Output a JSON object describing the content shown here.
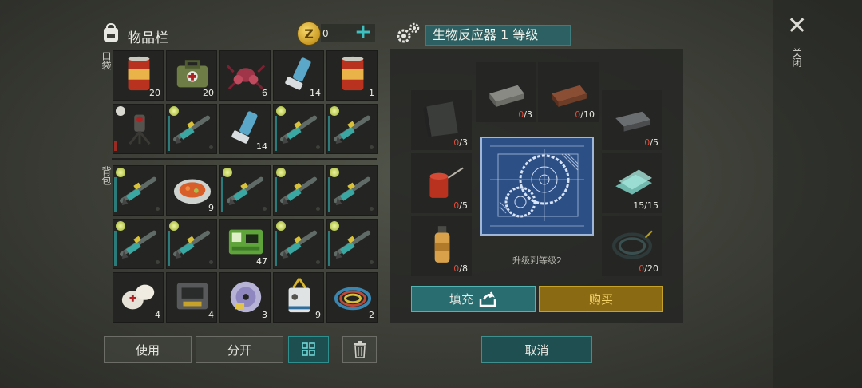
{
  "inventory": {
    "title": "物品栏",
    "coins": "0",
    "coin_symbol": "Z",
    "plus": "+",
    "pocket_label": "口袋",
    "backpack_label": "背包",
    "pocket": [
      {
        "name": "canned-food-icon",
        "count": "20"
      },
      {
        "name": "medkit-icon",
        "count": "20"
      },
      {
        "name": "mutant-spider-icon",
        "count": "6"
      },
      {
        "name": "inhaler-icon",
        "count": "14"
      },
      {
        "name": "canned-food-icon",
        "count": "1"
      },
      {
        "name": "turret-icon",
        "count": ""
      },
      {
        "name": "rifle-icon",
        "count": ""
      },
      {
        "name": "inhaler-icon",
        "count": "14"
      },
      {
        "name": "rifle-icon",
        "count": ""
      },
      {
        "name": "rifle-icon",
        "count": ""
      }
    ],
    "backpack": [
      {
        "name": "rifle-icon",
        "count": ""
      },
      {
        "name": "food-plate-icon",
        "count": "9"
      },
      {
        "name": "rifle-icon",
        "count": ""
      },
      {
        "name": "rifle-icon",
        "count": ""
      },
      {
        "name": "rifle-icon",
        "count": ""
      },
      {
        "name": "rifle-icon",
        "count": ""
      },
      {
        "name": "rifle-icon",
        "count": ""
      },
      {
        "name": "access-card-icon",
        "count": "47"
      },
      {
        "name": "rifle-icon",
        "count": ""
      },
      {
        "name": "rifle-icon",
        "count": ""
      },
      {
        "name": "bandage-icon",
        "count": "4"
      },
      {
        "name": "circuit-box-icon",
        "count": "4"
      },
      {
        "name": "disc-icon",
        "count": "3"
      },
      {
        "name": "id-badge-icon",
        "count": "9"
      },
      {
        "name": "wire-coil-icon",
        "count": "2"
      }
    ],
    "buttons": {
      "use": "使用",
      "split": "分开"
    }
  },
  "crafting": {
    "title": "生物反应器 1 等级",
    "upgrade_text": "升级到等级2",
    "fill_label": "填充",
    "buy_label": "购买",
    "cancel_label": "取消",
    "materials": [
      {
        "name": "metal-plate-icon",
        "have": "0",
        "need": "/3"
      },
      {
        "name": "steel-ingot-icon",
        "have": "0",
        "need": "/3"
      },
      {
        "name": "copper-ingot-icon",
        "have": "0",
        "need": "/10"
      },
      {
        "name": "iron-bar-icon",
        "have": "0",
        "need": "/5"
      },
      {
        "name": "oil-can-icon",
        "have": "0",
        "need": "/5"
      },
      {
        "name": "glass-icon",
        "have": "15",
        "need": "/15"
      },
      {
        "name": "gas-bottle-icon",
        "have": "0",
        "need": "/8"
      },
      {
        "name": "cable-coil-icon",
        "have": "0",
        "need": "/20"
      }
    ]
  },
  "close": {
    "symbol": "✕",
    "label": "关闭"
  },
  "colors": {
    "accent": "#2d6062",
    "gold": "#c99a24",
    "shortage": "#e04a3a"
  }
}
